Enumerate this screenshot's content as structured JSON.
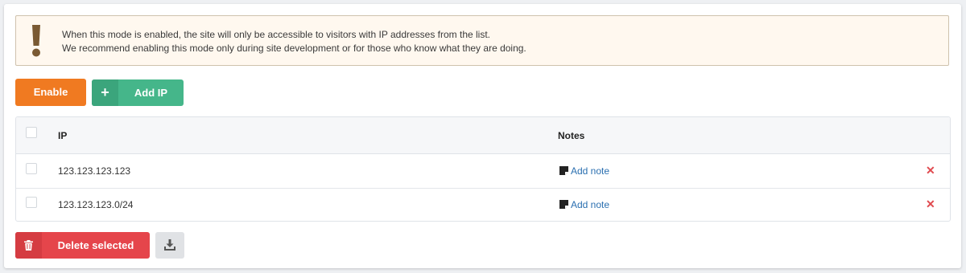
{
  "notice": {
    "line1": "When this mode is enabled, the site will only be accessible to visitors with IP addresses from the list.",
    "line2": "We recommend enabling this mode only during site development or for those who know what they are doing.",
    "icon": "exclamation-icon"
  },
  "toolbar": {
    "enable_label": "Enable",
    "add_ip_label": "Add IP",
    "add_ip_icon": "plus-icon"
  },
  "table": {
    "columns": [
      "IP",
      "Notes"
    ],
    "rows": [
      {
        "ip": "123.123.123.123",
        "note_label": "Add note"
      },
      {
        "ip": "123.123.123.0/24",
        "note_label": "Add note"
      }
    ],
    "delete_icon": "close-icon",
    "note_icon": "note-icon"
  },
  "footer": {
    "delete_selected_label": "Delete selected",
    "delete_icon": "trash-icon",
    "download_icon": "download-icon"
  },
  "colors": {
    "enable": "#f07a21",
    "add_ip": "#45b68a",
    "delete": "#e5454b",
    "link": "#2a6fb0",
    "notice_bg": "#fff8ef",
    "warning_icon": "#7a5a33"
  }
}
